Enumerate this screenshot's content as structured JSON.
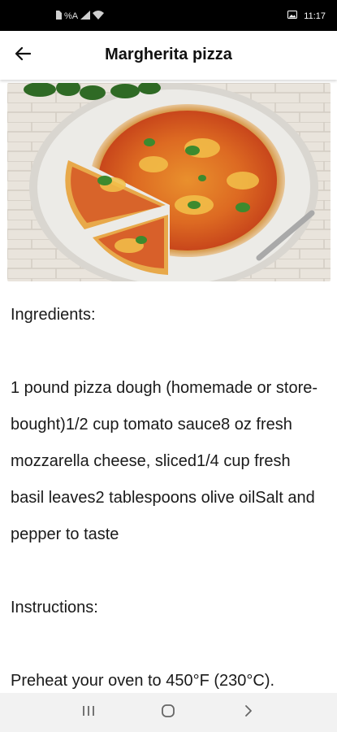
{
  "status_bar": {
    "left_indicators": "%A",
    "time": "11:17",
    "icons": [
      "sim-icon",
      "signal-icon",
      "wifi-icon",
      "photo-notification-icon"
    ]
  },
  "app_bar": {
    "title": "Margherita pizza",
    "back_icon": "arrow-left-icon"
  },
  "recipe": {
    "image_alt": "Margherita pizza",
    "ingredients_heading": "Ingredients:",
    "ingredients_text": "1 pound pizza dough (homemade or store-bought)1/2 cup tomato sauce8 oz fresh mozzarella cheese, sliced1/4 cup fresh basil leaves2 tablespoons olive oilSalt and pepper to taste",
    "instructions_heading": "Instructions:",
    "instructions_text": "Preheat your oven to 450°F (230°C)."
  },
  "nav_bar": {
    "recents_icon": "recent-apps-icon",
    "home_icon": "home-icon",
    "back_icon": "nav-back-icon"
  },
  "colors": {
    "status_bar": "#000000",
    "app_bar": "#ffffff",
    "text": "#1a1a1a",
    "nav_bar": "#f2f2f2"
  }
}
